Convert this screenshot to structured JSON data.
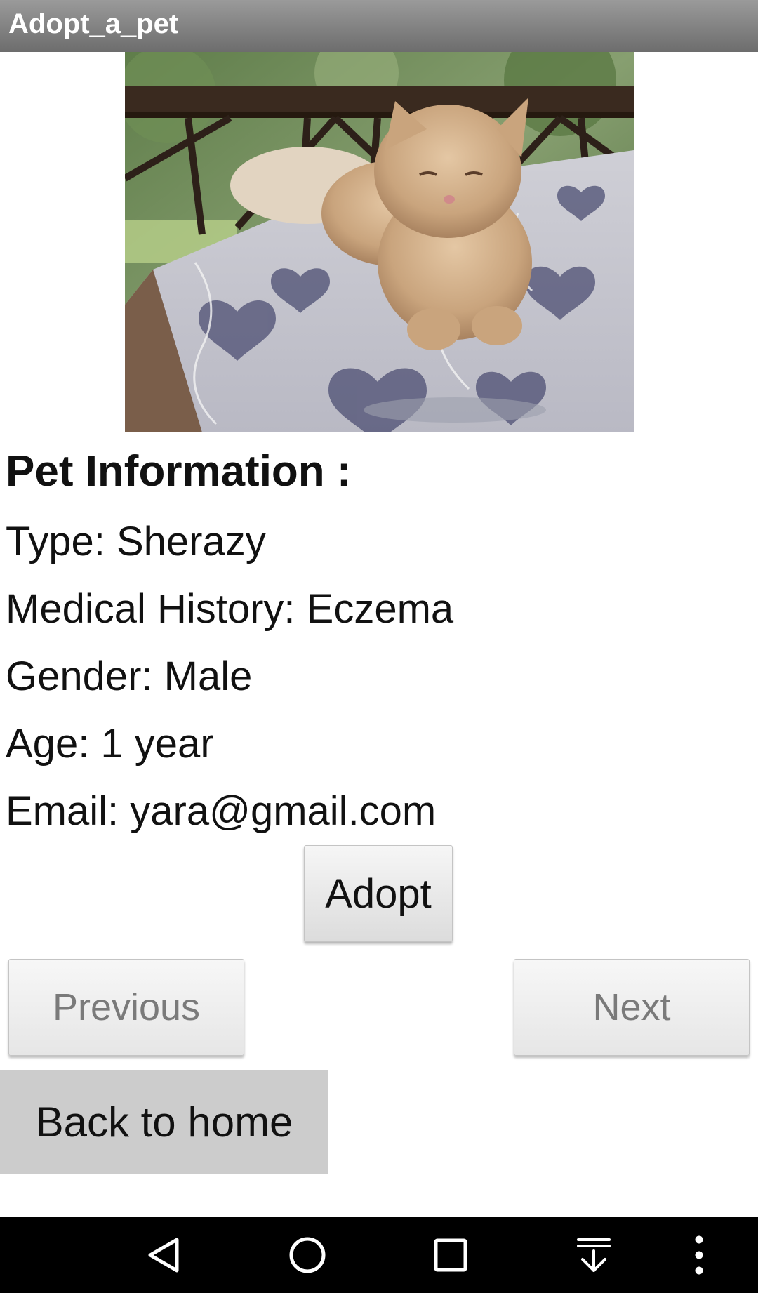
{
  "app": {
    "title": "Adopt_a_pet"
  },
  "pet": {
    "photo_icon": "cat-photo",
    "heading": "Pet Information :",
    "type": "Type: Sherazy",
    "medical_history": "Medical History: Eczema",
    "gender": "Gender: Male",
    "age": "Age: 1 year",
    "email": "Email: yara@gmail.com"
  },
  "actions": {
    "adopt_label": "Adopt",
    "previous_label": "Previous",
    "next_label": "Next",
    "home_label": "Back to home"
  },
  "system_nav": {
    "items": [
      "back-icon",
      "home-icon",
      "recents-icon",
      "notification-pull-icon",
      "more-options-icon"
    ]
  },
  "colors": {
    "title_bar": "#7d7d7d",
    "home_button": "#cccccc",
    "nav_bar": "#000000",
    "disabled_text": "#7a7a7a"
  }
}
